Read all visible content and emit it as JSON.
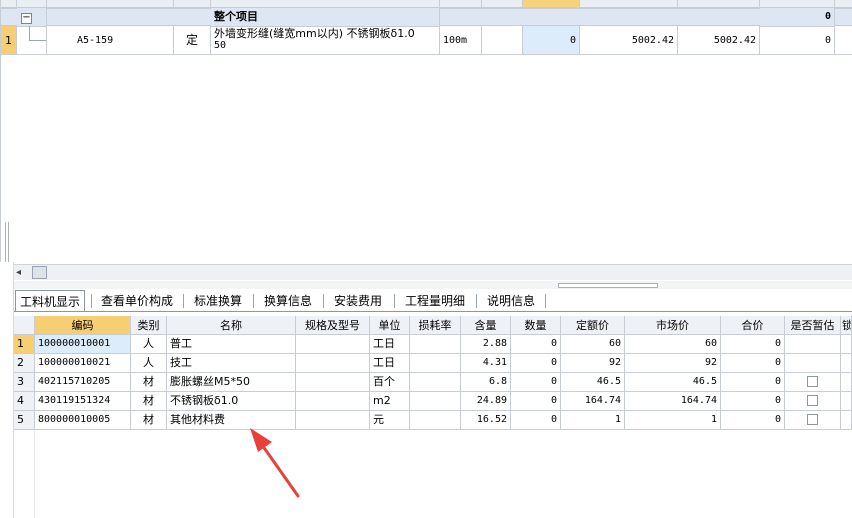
{
  "upper_grid": {
    "group_row": {
      "toggle": "−",
      "name": "整个项目",
      "total": "0"
    },
    "item_row": {
      "index": "1",
      "code": "A5-159",
      "type": "定",
      "name_line1": "外墙变形缝(缝宽mm以内) 不锈钢板δ1.0",
      "name_line2": "50",
      "unit": "100m",
      "quantity": "0",
      "unit_price": "5002.42",
      "converted_price": "5002.42",
      "total": "0"
    }
  },
  "scroll_arrow": "◂",
  "tabs": [
    {
      "label": "工料机显示",
      "active": true
    },
    {
      "label": "查看单价构成",
      "active": false
    },
    {
      "label": "标准换算",
      "active": false
    },
    {
      "label": "换算信息",
      "active": false
    },
    {
      "label": "安装费用",
      "active": false
    },
    {
      "label": "工程量明细",
      "active": false
    },
    {
      "label": "说明信息",
      "active": false
    }
  ],
  "lower_grid": {
    "columns": [
      "编码",
      "类别",
      "名称",
      "规格及型号",
      "单位",
      "损耗率",
      "含量",
      "数量",
      "定额价",
      "市场价",
      "合价",
      "是否暂估",
      "锁"
    ],
    "rows": [
      {
        "index": "1",
        "code": "100000010001",
        "type": "人",
        "name": "普工",
        "spec": "",
        "unit": "工日",
        "loss": "",
        "content": "2.88",
        "qty": "0",
        "quota_price": "60",
        "market_price": "60",
        "total": "0",
        "estimate": false
      },
      {
        "index": "2",
        "code": "100000010021",
        "type": "人",
        "name": "技工",
        "spec": "",
        "unit": "工日",
        "loss": "",
        "content": "4.31",
        "qty": "0",
        "quota_price": "92",
        "market_price": "92",
        "total": "0",
        "estimate": false
      },
      {
        "index": "3",
        "code": "402115710205",
        "type": "材",
        "name": "膨胀螺丝M5*50",
        "spec": "",
        "unit": "百个",
        "loss": "",
        "content": "6.8",
        "qty": "0",
        "quota_price": "46.5",
        "market_price": "46.5",
        "total": "0",
        "estimate": true
      },
      {
        "index": "4",
        "code": "430119151324",
        "type": "材",
        "name": "不锈钢板δ1.0",
        "spec": "",
        "unit": "m2",
        "loss": "",
        "content": "24.89",
        "qty": "0",
        "quota_price": "164.74",
        "market_price": "164.74",
        "total": "0",
        "estimate": true
      },
      {
        "index": "5",
        "code": "800000010005",
        "type": "材",
        "name": "其他材料费",
        "spec": "",
        "unit": "元",
        "loss": "",
        "content": "16.52",
        "qty": "0",
        "quota_price": "1",
        "market_price": "1",
        "total": "0",
        "estimate": true
      }
    ]
  },
  "colors": {
    "header_bg": "#eef1f6",
    "selected_header_bg": "#f6cf74",
    "selected_cell_bg": "#ddecfb",
    "annotation_arrow": "#e8413a"
  }
}
